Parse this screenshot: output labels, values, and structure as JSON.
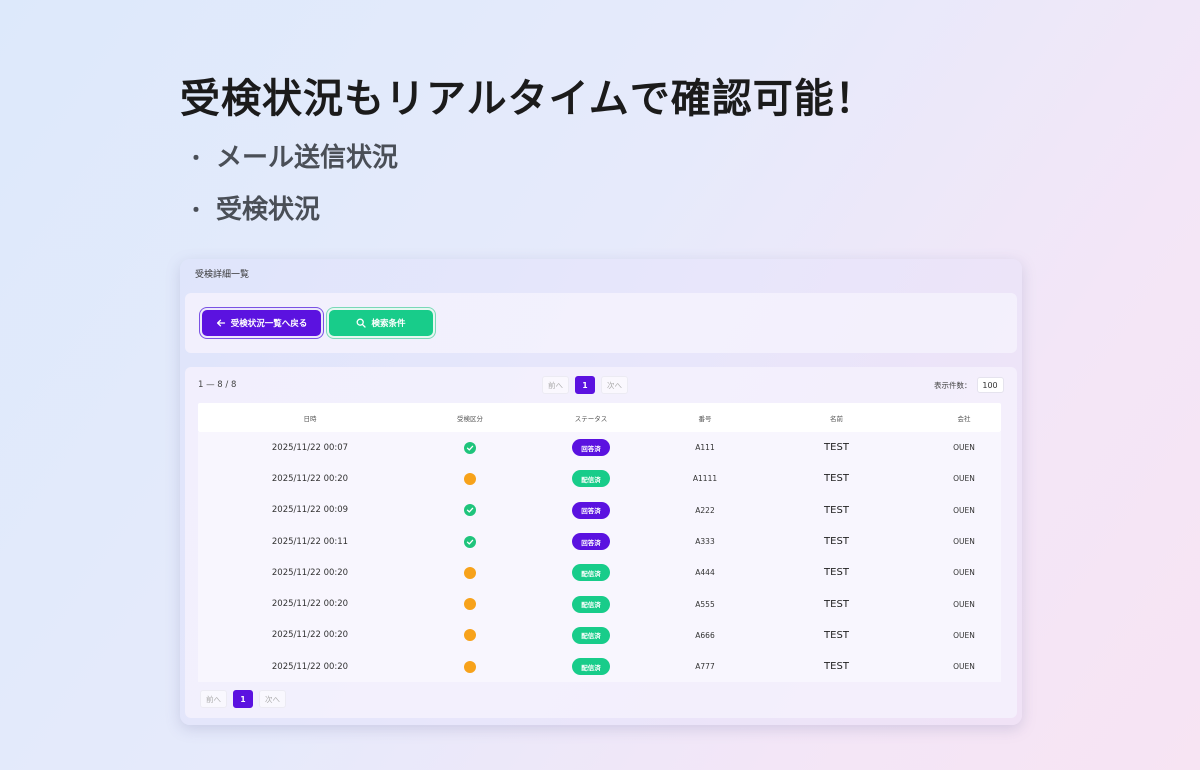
{
  "headline": "受検状況もリアルタイムで確認可能！",
  "bullets": [
    {
      "mark": "・",
      "text": "メール送信状況"
    },
    {
      "mark": "・",
      "text": "受検状況"
    }
  ],
  "panel": {
    "title": "受検詳細一覧",
    "back_button": "受検状況一覧へ戻る",
    "search_button": "検索条件",
    "range_text": "1 — 8 / 8",
    "pager": {
      "prev": "前へ",
      "current": "1",
      "next": "次へ"
    },
    "per_page_label": "表示件数：",
    "per_page_value": "100",
    "columns": [
      "日時",
      "受検区分",
      "ステータス",
      "番号",
      "名前",
      "会社"
    ],
    "rows": [
      {
        "datetime": "2025/11/22 00:07",
        "taken": "done",
        "status": "回答済",
        "status_color": "#5b12e0",
        "number": "A111",
        "name": "TEST",
        "company": "OUEN"
      },
      {
        "datetime": "2025/11/22 00:20",
        "taken": "pending",
        "status": "配信済",
        "status_color": "#18cc8a",
        "number": "A1111",
        "name": "TEST",
        "company": "OUEN"
      },
      {
        "datetime": "2025/11/22 00:09",
        "taken": "done",
        "status": "回答済",
        "status_color": "#5b12e0",
        "number": "A222",
        "name": "TEST",
        "company": "OUEN"
      },
      {
        "datetime": "2025/11/22 00:11",
        "taken": "done",
        "status": "回答済",
        "status_color": "#5b12e0",
        "number": "A333",
        "name": "TEST",
        "company": "OUEN"
      },
      {
        "datetime": "2025/11/22 00:20",
        "taken": "pending",
        "status": "配信済",
        "status_color": "#18cc8a",
        "number": "A444",
        "name": "TEST",
        "company": "OUEN"
      },
      {
        "datetime": "2025/11/22 00:20",
        "taken": "pending",
        "status": "配信済",
        "status_color": "#18cc8a",
        "number": "A555",
        "name": "TEST",
        "company": "OUEN"
      },
      {
        "datetime": "2025/11/22 00:20",
        "taken": "pending",
        "status": "配信済",
        "status_color": "#18cc8a",
        "number": "A666",
        "name": "TEST",
        "company": "OUEN"
      },
      {
        "datetime": "2025/11/22 00:20",
        "taken": "pending",
        "status": "配信済",
        "status_color": "#18cc8a",
        "number": "A777",
        "name": "TEST",
        "company": "OUEN"
      }
    ],
    "icons": {
      "back": "arrow-left-icon",
      "search": "search-icon",
      "done": "check-circle-icon",
      "pending": "pending-dot-icon"
    },
    "colors": {
      "accent": "#5b12e0",
      "green": "#18cc8a",
      "done": "#1fc47c",
      "pending": "#f7a21b"
    }
  }
}
